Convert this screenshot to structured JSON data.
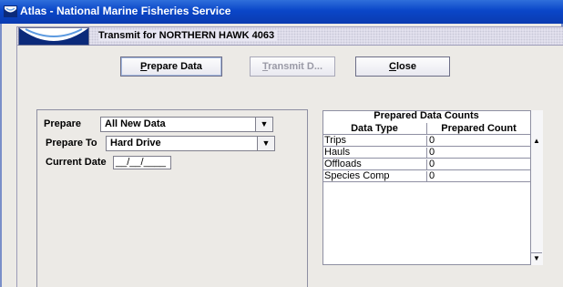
{
  "window": {
    "title": "Atlas - National Marine Fisheries Service"
  },
  "form": {
    "title": "Transmit for NORTHERN HAWK 4063"
  },
  "toolbar": {
    "prepare": {
      "prefix": "",
      "mnemonic": "P",
      "rest": "repare Data"
    },
    "transmit": {
      "prefix": "",
      "mnemonic": "T",
      "rest": "ransmit D..."
    },
    "close": {
      "prefix": "",
      "mnemonic": "C",
      "rest": "lose"
    }
  },
  "settings": {
    "prepare_label": "Prepare",
    "prepare_value": "All New Data",
    "prepare_to_label": "Prepare To",
    "prepare_to_value": "Hard Drive",
    "current_date_label": "Current Date",
    "current_date_value": "__/__/____"
  },
  "counts_table": {
    "title": "Prepared Data Counts",
    "headers": [
      "Data Type",
      "Prepared Count"
    ],
    "rows": [
      [
        "Trips",
        "0"
      ],
      [
        "Hauls",
        "0"
      ],
      [
        "Offloads",
        "0"
      ],
      [
        "Species Comp",
        "0"
      ]
    ]
  },
  "icons": {
    "app": "noaa-logo-icon",
    "combo_arrow": "chevron-down-icon",
    "scroll_up": "arrow-up-icon",
    "scroll_down": "arrow-down-icon"
  },
  "colors": {
    "titlebar": "#0a46c8",
    "frame": "#eceae6"
  }
}
